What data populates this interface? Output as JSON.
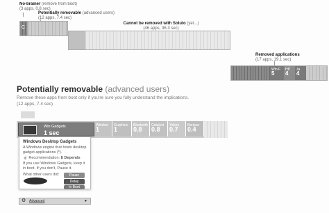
{
  "top": {
    "no_brainer": {
      "title": "No-brainer",
      "detail": "(remove from boot)",
      "stats": "(3 apps, 0.8 sec)"
    },
    "potentially": {
      "title": "Potentially removable",
      "detail": "(advanced users)",
      "stats": "(12 apps, 7.4 sec)"
    },
    "cannot": {
      "title": "Cannot be removed with Soluto",
      "detail": "(yet...)",
      "stats": "(46 apps, 36.3 sec)"
    },
    "removed": {
      "title": "Removed applications",
      "stats": "(17 apps, 19.1 sec)"
    },
    "small_cell_label": "C",
    "removed_cells": [
      {
        "name": "Win F",
        "value": "5"
      },
      {
        "name": "HP",
        "value": "4"
      },
      {
        "name": "Ja",
        "value": "4"
      }
    ]
  },
  "section": {
    "title": "Potentially removable",
    "title_sub": "(advanced users)",
    "description": "Remove these apps from boot only if you're sure you fully understand the implications.",
    "stats": "(12 apps, 7.4 sec)"
  },
  "row": {
    "first": {
      "name": "Win Gadgets",
      "value": "1 sec"
    },
    "cells": [
      {
        "name": "Window",
        "value": "1"
      },
      {
        "name": "Graphics",
        "value": "1"
      },
      {
        "name": "Bluetooth",
        "value": "0.8"
      },
      {
        "name": "Catalyst",
        "value": "0.8"
      },
      {
        "name": "Yahoo",
        "value": "0.7"
      },
      {
        "name": "Bonjour",
        "value": "0.4"
      }
    ]
  },
  "popup": {
    "title": "Windows Desktop Gadgets",
    "description": "A Windows engine that hosts desktop gadget applications (*).",
    "recommendation_label": "Recommendation:",
    "recommendation_value": "It Depends",
    "advice": "If you use Windows Gadgets, keep it in boot. If you don't, Pause it.",
    "users_label": "What other users did:",
    "actions": [
      "Pause",
      "Delay",
      "In Boot"
    ],
    "footer": "Advanced"
  }
}
